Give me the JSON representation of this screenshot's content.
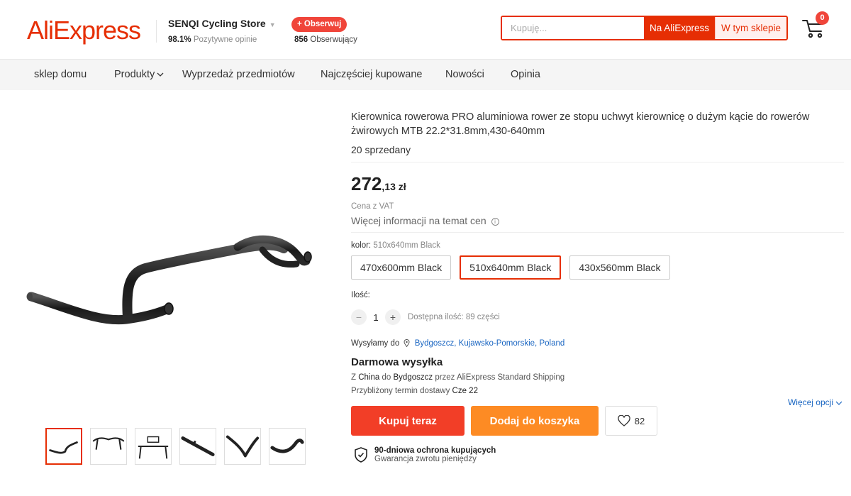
{
  "header": {
    "logo": "AliExpress",
    "store_name": "SENQI Cycling Store",
    "rating_value": "98.1%",
    "rating_label": "Pozytywne opinie",
    "follow_label": "+ Obserwuj",
    "followers_count": "856",
    "followers_label": "Obserwujący",
    "search_placeholder": "Kupuję...",
    "search_all_label": "Na AliExpress",
    "search_store_label": "W tym sklepie",
    "cart_count": "0"
  },
  "nav": {
    "items": [
      "sklep domu",
      "Produkty",
      "Wyprzedaż przedmiotów",
      "Najczęściej kupowane",
      "Nowości",
      "Opinia"
    ]
  },
  "product": {
    "title": "Kierownica rowerowa PRO aluminiowa rower ze stopu uchwyt kierownicę o dużym kącie do rowerów żwirowych MTB 22.2*31.8mm,430-640mm",
    "sold": "20 sprzedany",
    "price_int": "272",
    "price_frac": ",13 zł",
    "vat_note": "Cena z VAT",
    "more_price_info": "Więcej informacji na temat cen",
    "color_label": "kolor:",
    "color_selected": "510x640mm Black",
    "variants": [
      "470x600mm Black",
      "510x640mm Black",
      "430x560mm Black"
    ],
    "quantity_label": "Ilość:",
    "quantity": "1",
    "available": "Dostępna ilość: 89 części",
    "ship_to_label": "Wysyłamy do",
    "ship_to_location": "Bydgoszcz, Kujawsko-Pomorskie, Poland",
    "free_shipping": "Darmowa wysyłka",
    "ship_from_prefix": "Z",
    "ship_from": "China",
    "ship_to_prefix": "do",
    "ship_to_city": "Bydgoszcz",
    "ship_via": "przez AliExpress Standard Shipping",
    "eta_label": "Przybliżony termin dostawy",
    "eta_date": "Cze 22",
    "more_options": "Więcej opcji",
    "buy_now": "Kupuj teraz",
    "add_to_cart": "Dodaj do koszyka",
    "wishlist_count": "82",
    "protection_title": "90-dniowa ochrona kupujących",
    "protection_sub": "Gwarancja zwrotu pieniędzy"
  },
  "colors": {
    "brand": "#e62e04",
    "buy": "#f23e27",
    "cart": "#fd8b24",
    "link": "#1a66c2"
  },
  "icons": {
    "cart": "cart-icon",
    "wishlist": "heart-icon",
    "location": "pin-icon",
    "protection": "shield-check-icon",
    "info": "info-icon"
  }
}
